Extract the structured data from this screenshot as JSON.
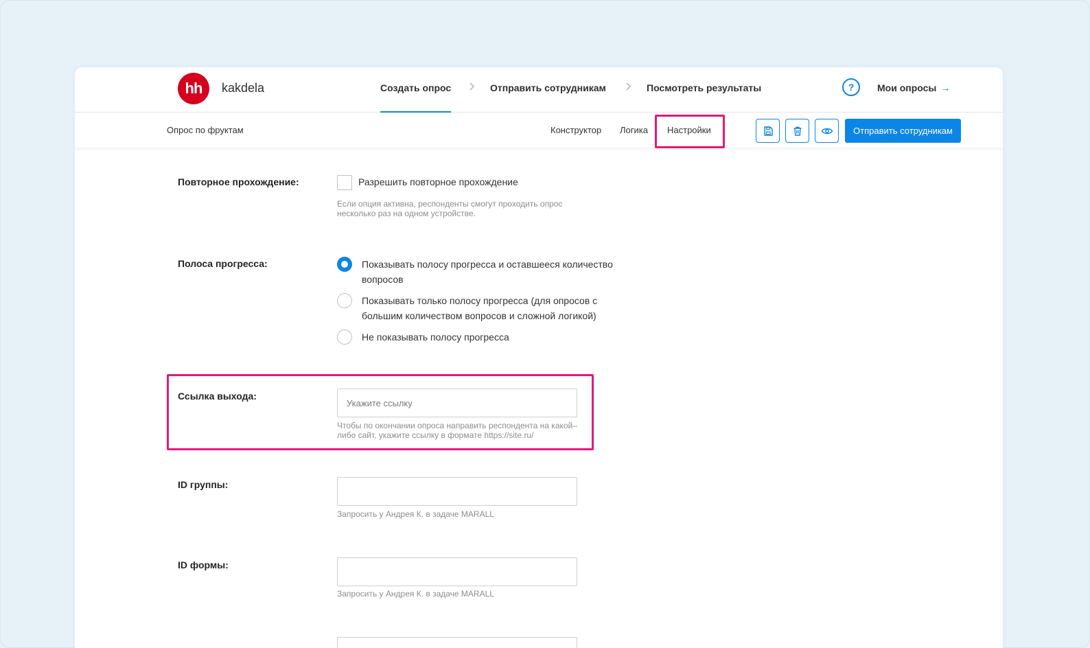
{
  "header": {
    "logo": "hh",
    "brand": "kakdela",
    "steps": [
      "Создать опрос",
      "Отправить сотрудникам",
      "Посмотреть результаты"
    ],
    "help": "?",
    "my_surveys": "Мои опросы",
    "my_surveys_arrow": "→"
  },
  "subbar": {
    "survey_name": "Опрос по фруктам",
    "tabs": [
      "Конструктор",
      "Логика",
      "Настройки"
    ],
    "active_tab": "Настройки",
    "send_button": "Отправить сотрудникам"
  },
  "form": {
    "repeat": {
      "label": "Повторное прохождение:",
      "checkbox_label": "Разрешить повторное прохождение",
      "checked": false,
      "hint": "Если опция активна, респонденты смогут проходить опрос несколько раз на одном устройстве."
    },
    "progress": {
      "label": "Полоса прогресса:",
      "options": [
        "Показывать полосу прогресса и оставшееся количество вопросов",
        "Показывать только полосу прогресса (для опросов с большим количеством вопросов и сложной логикой)",
        "Не показывать полосу прогресса"
      ],
      "selected_index": 0
    },
    "exit_link": {
      "label": "Ссылка выхода:",
      "placeholder": "Укажите ссылку",
      "value": "",
      "hint": "Чтобы по окончании опроса направить респондента на какой–либо сайт, укажите ссылку в формате https://site.ru/"
    },
    "group_id": {
      "label": "ID группы:",
      "value": "",
      "hint": "Запросить у Андрея К. в задаче MARALL"
    },
    "form_id": {
      "label": "ID формы:",
      "value": "",
      "hint": "Запросить у Андрея К. в задаче MARALL"
    }
  },
  "colors": {
    "accent": "#0b86e6",
    "highlight": "#e0197d",
    "logo": "#d6001c",
    "background": "#e6f1f8"
  },
  "icons": [
    "save-icon",
    "trash-icon",
    "eye-icon",
    "chevron-right-icon",
    "arrow-right-icon"
  ]
}
